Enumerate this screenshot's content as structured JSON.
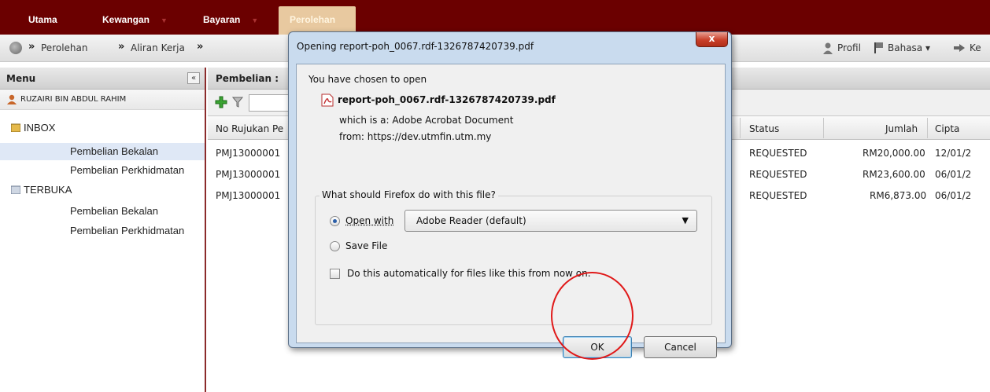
{
  "topnav": {
    "tabs": [
      {
        "label": "Utama"
      },
      {
        "label": "Kewangan"
      },
      {
        "label": "Bayaran"
      },
      {
        "label": "Perolehan"
      }
    ],
    "dropdown_indicator": "▼"
  },
  "breadcrumb": {
    "separator": "»",
    "items": [
      "Perolehan",
      "Aliran Kerja"
    ],
    "right_links": {
      "profile": "Profil",
      "language": "Bahasa ▾",
      "logout": "Ke"
    }
  },
  "menu": {
    "title": "Menu",
    "collapse": "«",
    "user": "RUZAIRI BIN ABDUL RAHIM",
    "inbox": {
      "label": "INBOX",
      "items": [
        "Pembelian Bekalan",
        "Pembelian Perkhidmatan"
      ]
    },
    "terbuka": {
      "label": "TERBUKA",
      "items": [
        "Pembelian Bekalan",
        "Pembelian Perkhidmatan"
      ]
    }
  },
  "grid": {
    "title": "Pembelian :",
    "columns": {
      "ref": "No Rujukan Pe",
      "status": "Status",
      "amount": "Jumlah",
      "created": "Cipta"
    },
    "rows": [
      {
        "ref": "PMJ13000001",
        "status": "REQUESTED",
        "amount": "RM20,000.00",
        "created": "12/01/2"
      },
      {
        "ref": "PMJ13000001",
        "status": "REQUESTED",
        "amount": "RM23,600.00",
        "created": "06/01/2"
      },
      {
        "ref": "PMJ13000001",
        "status": "REQUESTED",
        "amount": "RM6,873.00",
        "created": "06/01/2"
      }
    ]
  },
  "dialog": {
    "title": "Opening report-poh_0067.rdf-1326787420739.pdf",
    "close": "x",
    "intro": "You have chosen to open",
    "filename": "report-poh_0067.rdf-1326787420739.pdf",
    "type_line": "which is a:  Adobe Acrobat Document",
    "from_line": "from:  https://dev.utmfin.utm.my",
    "question": "What should Firefox do with this file?",
    "open_with": "Open with",
    "open_with_app": "Adobe Reader  (default)",
    "save_file": "Save File",
    "auto_check": "Do this automatically for files like this from now on.",
    "ok": "OK",
    "cancel": "Cancel"
  },
  "colors": {
    "nav_bg": "#6b0000",
    "active_tab": "#e8c9a0",
    "highlight_circle": "#e01919"
  }
}
